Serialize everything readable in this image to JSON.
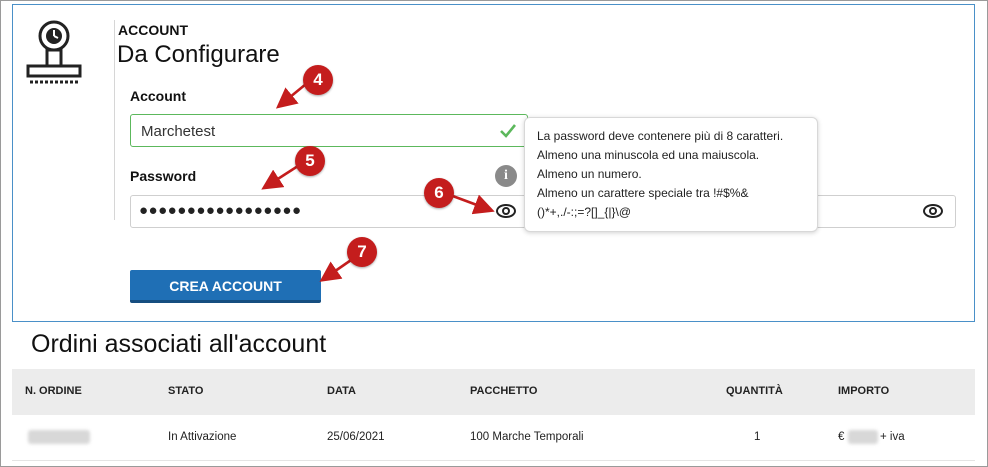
{
  "account": {
    "section_label": "ACCOUNT",
    "title": "Da Configurare",
    "account_label": "Account",
    "account_value": "Marchetest",
    "password_label": "Password",
    "password_value": "●●●●●●●●●●●●●●●●●",
    "tooltip_lines": [
      "La password deve contenere più di 8 caratteri.",
      "Almeno una minuscola ed una maiuscola.",
      "Almeno un numero.",
      "Almeno un carattere speciale tra !#$%&",
      "()*+,./-:;=?[]_{|}\\@"
    ],
    "info_glyph": "i",
    "create_button": "CREA ACCOUNT"
  },
  "badges": [
    "4",
    "5",
    "6",
    "7"
  ],
  "orders": {
    "title": "Ordini associati all'account",
    "columns": [
      "N. ORDINE",
      "STATO",
      "DATA",
      "PACCHETTO",
      "QUANTITÀ",
      "IMPORTO"
    ],
    "rows": [
      {
        "stato": "In Attivazione",
        "data": "25/06/2021",
        "pacchetto": "100 Marche Temporali",
        "quantita": "1",
        "importo_prefix": "€",
        "importo_suffix": "+ iva"
      }
    ]
  },
  "colors": {
    "accent": "#1f6fb5",
    "badge": "#c41d1d",
    "valid": "#5cb85c",
    "arrow": "#c41d1d"
  },
  "icons": [
    "stamp-icon",
    "check-icon",
    "info-icon",
    "eye-icon",
    "arrow-icon"
  ]
}
